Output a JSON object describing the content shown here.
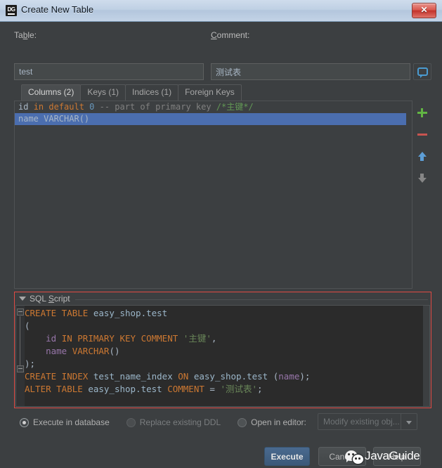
{
  "window": {
    "title": "Create New Table",
    "app_icon": "datagrip-dg-icon",
    "close_label": "✕"
  },
  "form": {
    "table_label_pre": "Ta",
    "table_label_mnemonic": "b",
    "table_label_post": "le:",
    "table_value": "test",
    "comment_label_mnemonic": "C",
    "comment_label_post": "omment:",
    "comment_value": "测试表",
    "comment_button_icon": "speech-bubble-icon"
  },
  "tabs": [
    {
      "label": "Columns (2)",
      "selected": true
    },
    {
      "label": "Keys (1)",
      "selected": false
    },
    {
      "label": "Indices (1)",
      "selected": false
    },
    {
      "label": "Foreign Keys",
      "selected": false
    }
  ],
  "columns_list": {
    "rows": [
      {
        "selected": false,
        "parts": [
          {
            "t": "id ",
            "c": "ident"
          },
          {
            "t": "in ",
            "c": "kw"
          },
          {
            "t": "default ",
            "c": "kw"
          },
          {
            "t": "0 ",
            "c": "num"
          },
          {
            "t": "-- part of primary key ",
            "c": "cmt"
          },
          {
            "t": "/*主键*/",
            "c": "cmtb"
          }
        ]
      },
      {
        "selected": true,
        "parts": [
          {
            "t": "name VARCHAR()",
            "c": "ident"
          }
        ]
      }
    ]
  },
  "list_toolbar": [
    {
      "icon": "plus-icon",
      "name": "add-column-button"
    },
    {
      "icon": "minus-icon",
      "name": "remove-column-button"
    },
    {
      "icon": "arrow-up-icon",
      "name": "move-up-button"
    },
    {
      "icon": "arrow-down-icon",
      "name": "move-down-button"
    }
  ],
  "sql_panel": {
    "header_pre": "SQL ",
    "header_mnemonic": "S",
    "header_post": "cript",
    "collapse_icon": "triangle-down-icon",
    "lines": [
      [
        {
          "t": "CREATE TABLE ",
          "c": "k"
        },
        {
          "t": "easy_shop.test",
          "c": "id2"
        }
      ],
      [
        {
          "t": "(",
          "c": "pl"
        }
      ],
      [
        {
          "t": "    ",
          "c": "pl"
        },
        {
          "t": "id",
          "c": "col"
        },
        {
          "t": " IN PRIMARY KEY COMMENT ",
          "c": "k"
        },
        {
          "t": "'主键'",
          "c": "str"
        },
        {
          "t": ",",
          "c": "pl"
        }
      ],
      [
        {
          "t": "    ",
          "c": "pl"
        },
        {
          "t": "name",
          "c": "col"
        },
        {
          "t": " VARCHAR",
          "c": "k"
        },
        {
          "t": "()",
          "c": "pl"
        }
      ],
      [
        {
          "t": ");",
          "c": "pl"
        }
      ],
      [
        {
          "t": "CREATE INDEX ",
          "c": "k"
        },
        {
          "t": "test_name_index",
          "c": "id2"
        },
        {
          "t": " ON ",
          "c": "k"
        },
        {
          "t": "easy_shop.test",
          "c": "id2"
        },
        {
          "t": " (",
          "c": "pl"
        },
        {
          "t": "name",
          "c": "col"
        },
        {
          "t": ");",
          "c": "pl"
        }
      ],
      [
        {
          "t": "ALTER TABLE ",
          "c": "k"
        },
        {
          "t": "easy_shop.test",
          "c": "id2"
        },
        {
          "t": " COMMENT ",
          "c": "k"
        },
        {
          "t": "= ",
          "c": "pl"
        },
        {
          "t": "'测试表'",
          "c": "str"
        },
        {
          "t": ";",
          "c": "pl"
        }
      ]
    ]
  },
  "options": {
    "radios": [
      {
        "label": "Execute in database",
        "selected": true,
        "enabled": true
      },
      {
        "label": "Replace existing DDL",
        "selected": false,
        "enabled": false
      },
      {
        "label": "Open in editor:",
        "selected": false,
        "enabled": true
      }
    ],
    "dropdown_value": "Modify existing obj...",
    "dropdown_enabled": false
  },
  "actions": {
    "execute_label": "Execute",
    "cancel_label": "Cancel",
    "help_label": "Help"
  },
  "watermark": {
    "text": "JavaGuide",
    "icon": "wechat-icon"
  },
  "colors": {
    "accent_blue": "#4b6eaf",
    "keyword_orange": "#cc7832",
    "string_green": "#6a8759",
    "identifier_blue": "#9bb6c9",
    "column_purple": "#9876aa",
    "panel_border_red": "#e04a44",
    "plus_green": "#62b543",
    "minus_red": "#c75450",
    "editor_bg": "#2b2b2b",
    "dialog_bg": "#3c3f41"
  }
}
